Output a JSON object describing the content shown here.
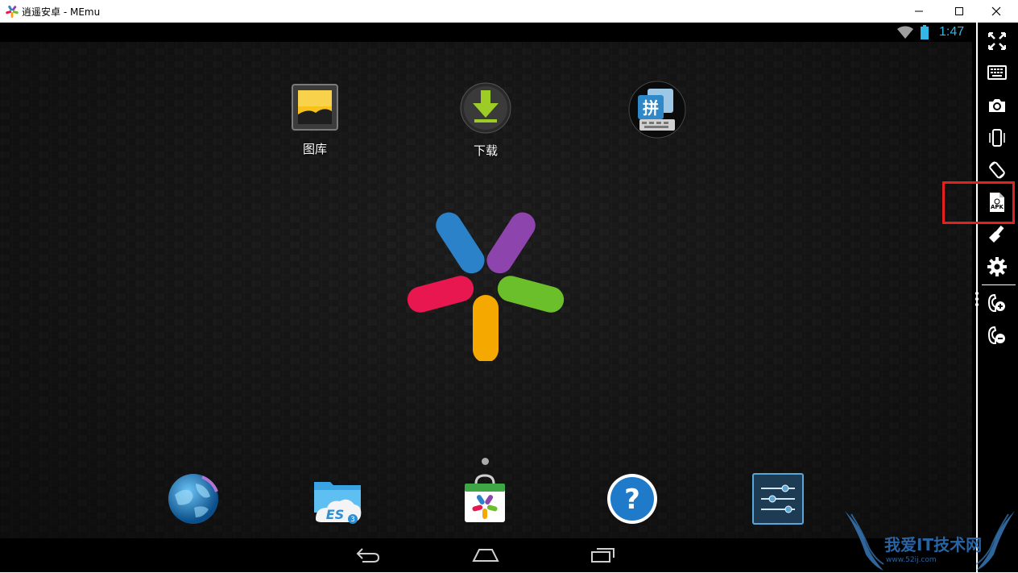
{
  "window": {
    "title": "逍遥安卓 - MEmu",
    "controls": [
      "minimize",
      "maximize",
      "close"
    ]
  },
  "status_bar": {
    "time": "1:47",
    "icons": [
      "wifi-icon",
      "battery-icon"
    ],
    "accent_color": "#33b5e5"
  },
  "home": {
    "top_apps": [
      {
        "label": "图库",
        "icon": "gallery-icon"
      },
      {
        "label": "下载",
        "icon": "download-icon"
      },
      {
        "label": "",
        "icon": "pinyin-keyboard-icon"
      }
    ],
    "center_logo": "memu-logo",
    "dock_apps": [
      {
        "icon": "browser-globe-icon"
      },
      {
        "icon": "es-file-explorer-icon"
      },
      {
        "icon": "memu-market-icon"
      },
      {
        "icon": "help-icon"
      },
      {
        "icon": "settings-sliders-icon"
      }
    ]
  },
  "nav_bar": [
    "back-icon",
    "home-icon",
    "recent-apps-icon"
  ],
  "toolbar": {
    "items": [
      "fullscreen-icon",
      "keyboard-icon",
      "screenshot-camera-icon",
      "shake-phone-icon",
      "rotate-icon",
      "install-apk-icon",
      "clean-brush-icon",
      "settings-gear-icon",
      "volume-up-icon",
      "volume-down-icon"
    ],
    "highlight_color": "#e5211f"
  },
  "watermark": {
    "text": "我爱IT技术网",
    "sub": "www.52ij.com"
  }
}
